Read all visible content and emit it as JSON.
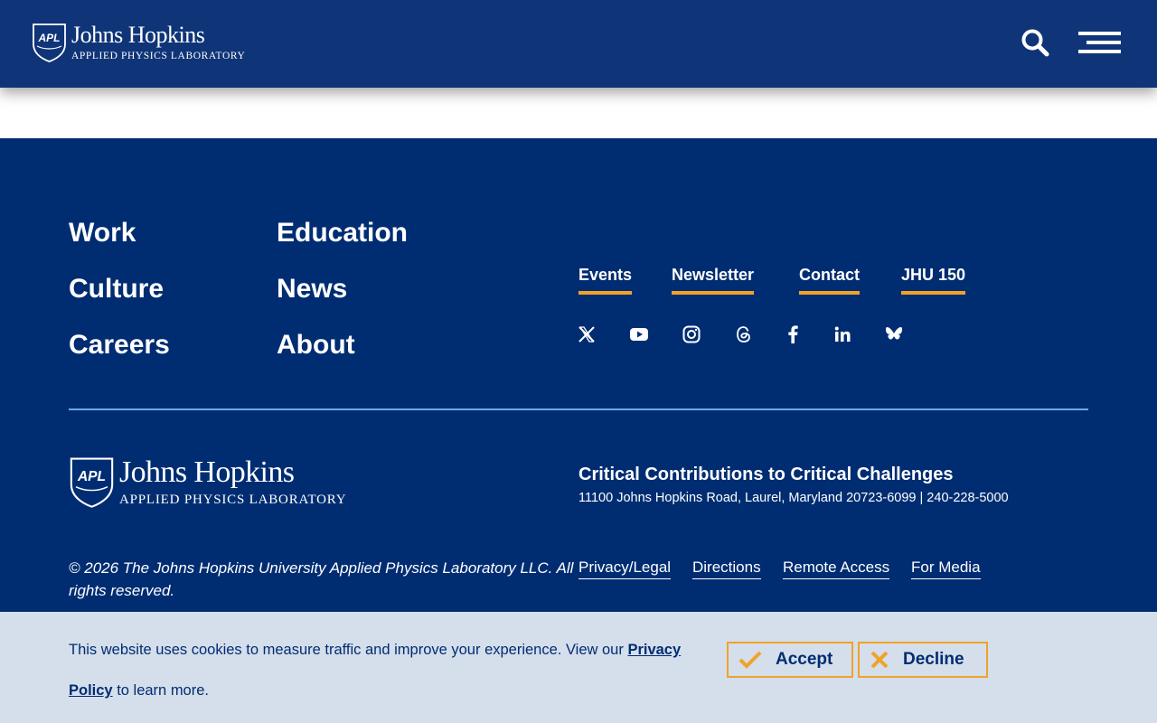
{
  "header": {
    "logo_abbr": "APL",
    "logo_main": "Johns Hopkins",
    "logo_sub": "APPLIED PHYSICS LABORATORY",
    "search_icon": "search-icon",
    "menu_icon": "hamburger-menu-icon"
  },
  "footer": {
    "nav": [
      "Work",
      "Education",
      "Culture",
      "News",
      "Careers",
      "About"
    ],
    "utility_links": [
      "Events",
      "Newsletter",
      "Contact",
      "JHU 150"
    ],
    "social_icons": [
      "x-twitter-icon",
      "youtube-icon",
      "instagram-icon",
      "threads-icon",
      "facebook-icon",
      "linkedin-icon",
      "bluesky-icon"
    ],
    "tagline": "Critical Contributions to Critical Challenges",
    "address": "11100 Johns Hopkins Road, Laurel, Maryland 20723-6099 | 240-228-5000",
    "copyright": "© 2026 The Johns Hopkins University Applied Physics Laboratory LLC. All rights reserved.",
    "legal_links": [
      "Privacy/Legal",
      "Directions",
      "Remote Access",
      "For Media"
    ]
  },
  "cookie_banner": {
    "text_before": "This website uses cookies to measure traffic and improve your experience. View our ",
    "privacy_link": "Privacy Policy",
    "text_after": " to learn more.",
    "accept_label": "Accept",
    "decline_label": "Decline"
  },
  "colors": {
    "header_bg": "#0f3478",
    "footer_bg": "#002d72",
    "accent": "#f0a329",
    "divider": "#68ace5",
    "cookie_bg": "#dee6f0"
  }
}
